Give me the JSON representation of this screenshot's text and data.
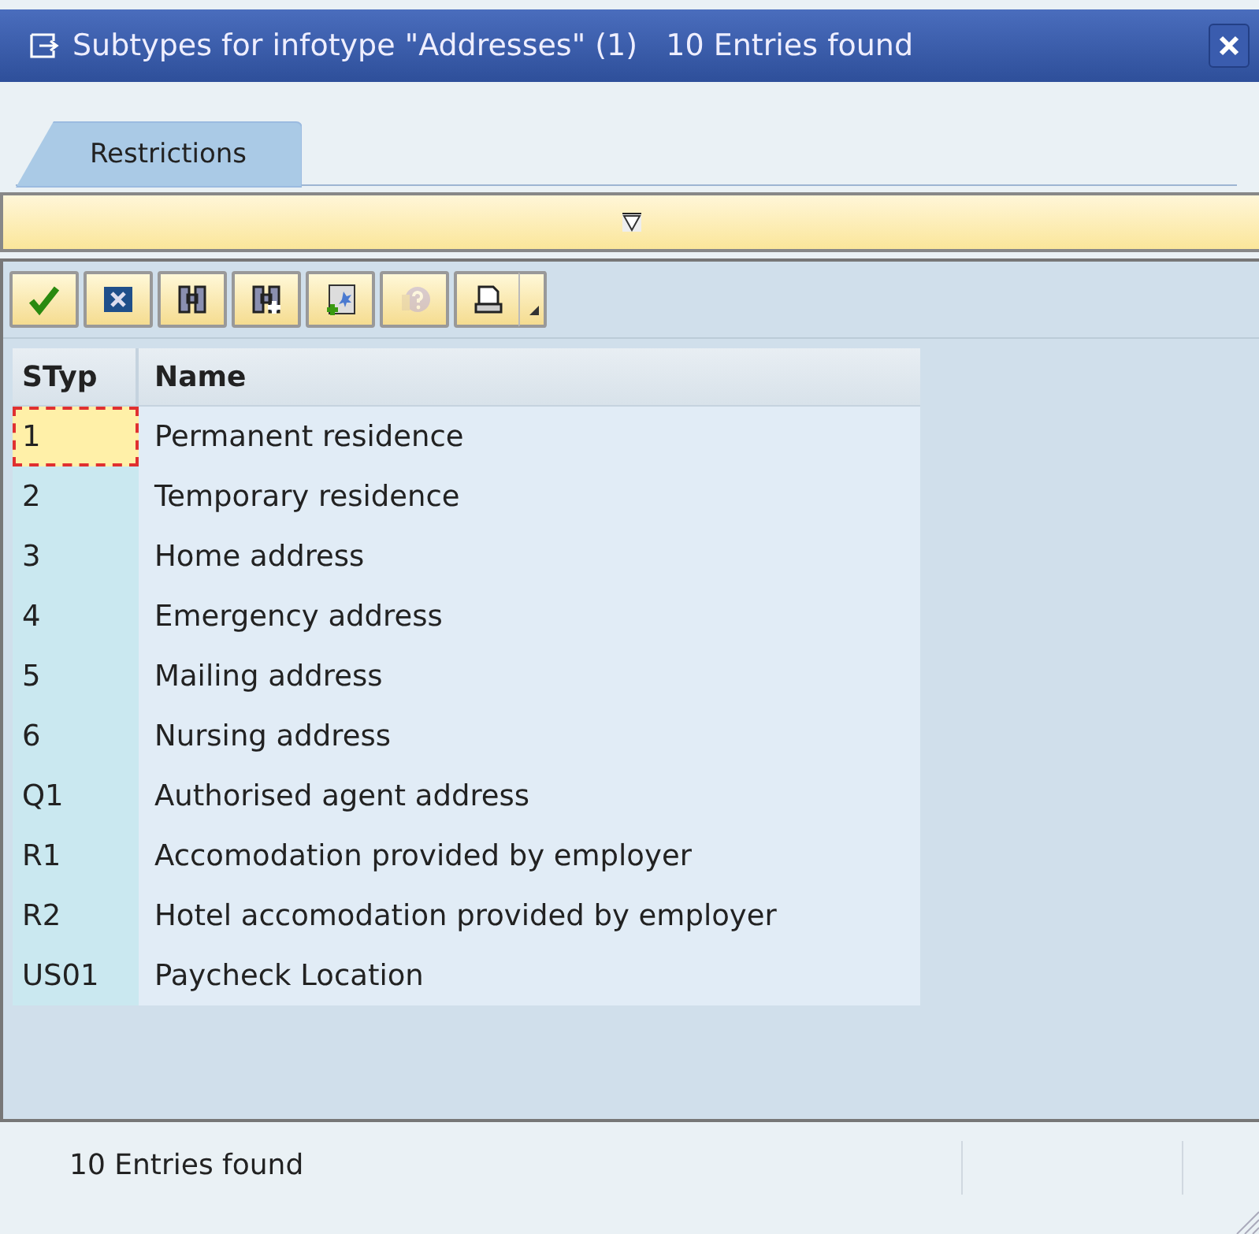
{
  "window": {
    "title": "Subtypes for infotype \"Addresses\" (1)   10 Entries found"
  },
  "tabs": [
    {
      "label": "Restrictions",
      "selected": true
    }
  ],
  "toolbar": [
    {
      "kind": "check",
      "disabled": false
    },
    {
      "kind": "cancel",
      "disabled": false
    },
    {
      "kind": "find",
      "disabled": false
    },
    {
      "kind": "find-next",
      "disabled": false
    },
    {
      "kind": "new",
      "disabled": false
    },
    {
      "kind": "help",
      "disabled": true
    },
    {
      "kind": "print",
      "disabled": false
    }
  ],
  "table": {
    "columns": [
      "STyp",
      "Name"
    ],
    "rows": [
      {
        "cells": [
          "1",
          "Permanent residence"
        ],
        "focused": true
      },
      {
        "cells": [
          "2",
          "Temporary residence"
        ],
        "focused": false
      },
      {
        "cells": [
          "3",
          "Home address"
        ],
        "focused": false
      },
      {
        "cells": [
          "4",
          "Emergency address"
        ],
        "focused": false
      },
      {
        "cells": [
          "5",
          "Mailing address"
        ],
        "focused": false
      },
      {
        "cells": [
          "6",
          "Nursing address"
        ],
        "focused": false
      },
      {
        "cells": [
          "Q1",
          "Authorised agent address"
        ],
        "focused": false
      },
      {
        "cells": [
          "R1",
          "Accomodation provided by employer"
        ],
        "focused": false
      },
      {
        "cells": [
          "R2",
          "Hotel accomodation provided by employer"
        ],
        "focused": false
      },
      {
        "cells": [
          "US01",
          "Paycheck Location"
        ],
        "focused": false
      }
    ]
  },
  "status_bar": {
    "text": "10 Entries found"
  }
}
